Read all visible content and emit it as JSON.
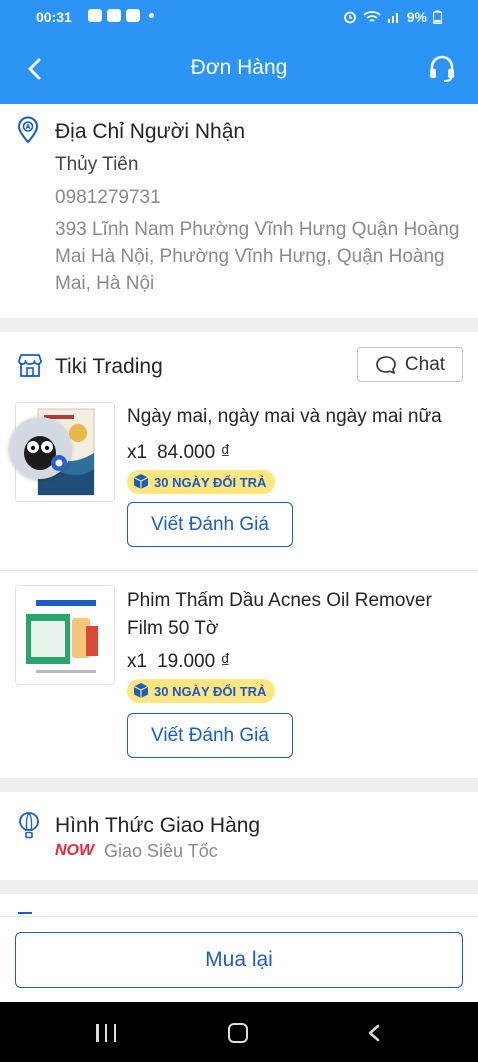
{
  "status_bar": {
    "time": "00:31",
    "battery": "9%",
    "app_icons": [
      "zalo-icon",
      "gallery-icon",
      "instagram-icon",
      "dot-icon"
    ],
    "system_icons": [
      "alarm-icon",
      "wifi-icon",
      "signal-icon",
      "battery-icon"
    ]
  },
  "header": {
    "title": "Đơn Hàng"
  },
  "recipient": {
    "heading": "Địa Chỉ Người Nhận",
    "name": "Thủy Tiên",
    "phone": "0981279731",
    "address": "393 Lĩnh Nam Phường Vĩnh Hưng Quận Hoàng Mai Hà Nội, Phường Vĩnh Hưng, Quận Hoàng Mai, Hà Nội"
  },
  "shop": {
    "name": "Tiki Trading",
    "chat_label": "Chat"
  },
  "items": [
    {
      "name": "Ngày mai, ngày mai và ngày mai nữa",
      "qty": "x1",
      "price": "84.000 ₫",
      "badge": "30 NGÀY ĐỔI TRẢ",
      "review_label": "Viết Đánh Giá"
    },
    {
      "name": "Phim Thấm Dầu Acnes Oil Remover Film 50 Tờ",
      "qty": "x1",
      "price": "19.000 ₫",
      "badge": "30 NGÀY ĐỔI TRẢ",
      "review_label": "Viết Đánh Giá"
    }
  ],
  "shipping": {
    "heading": "Hình Thức Giao Hàng",
    "now_tag": "NOW",
    "method": "Giao Siêu Tốc"
  },
  "footer": {
    "buy_again_label": "Mua lại"
  },
  "colors": {
    "header_blue": "#2b94f5",
    "accent_blue": "#1a5fbf",
    "badge_yellow": "#ffe67f",
    "now_red": "#e6283a"
  }
}
